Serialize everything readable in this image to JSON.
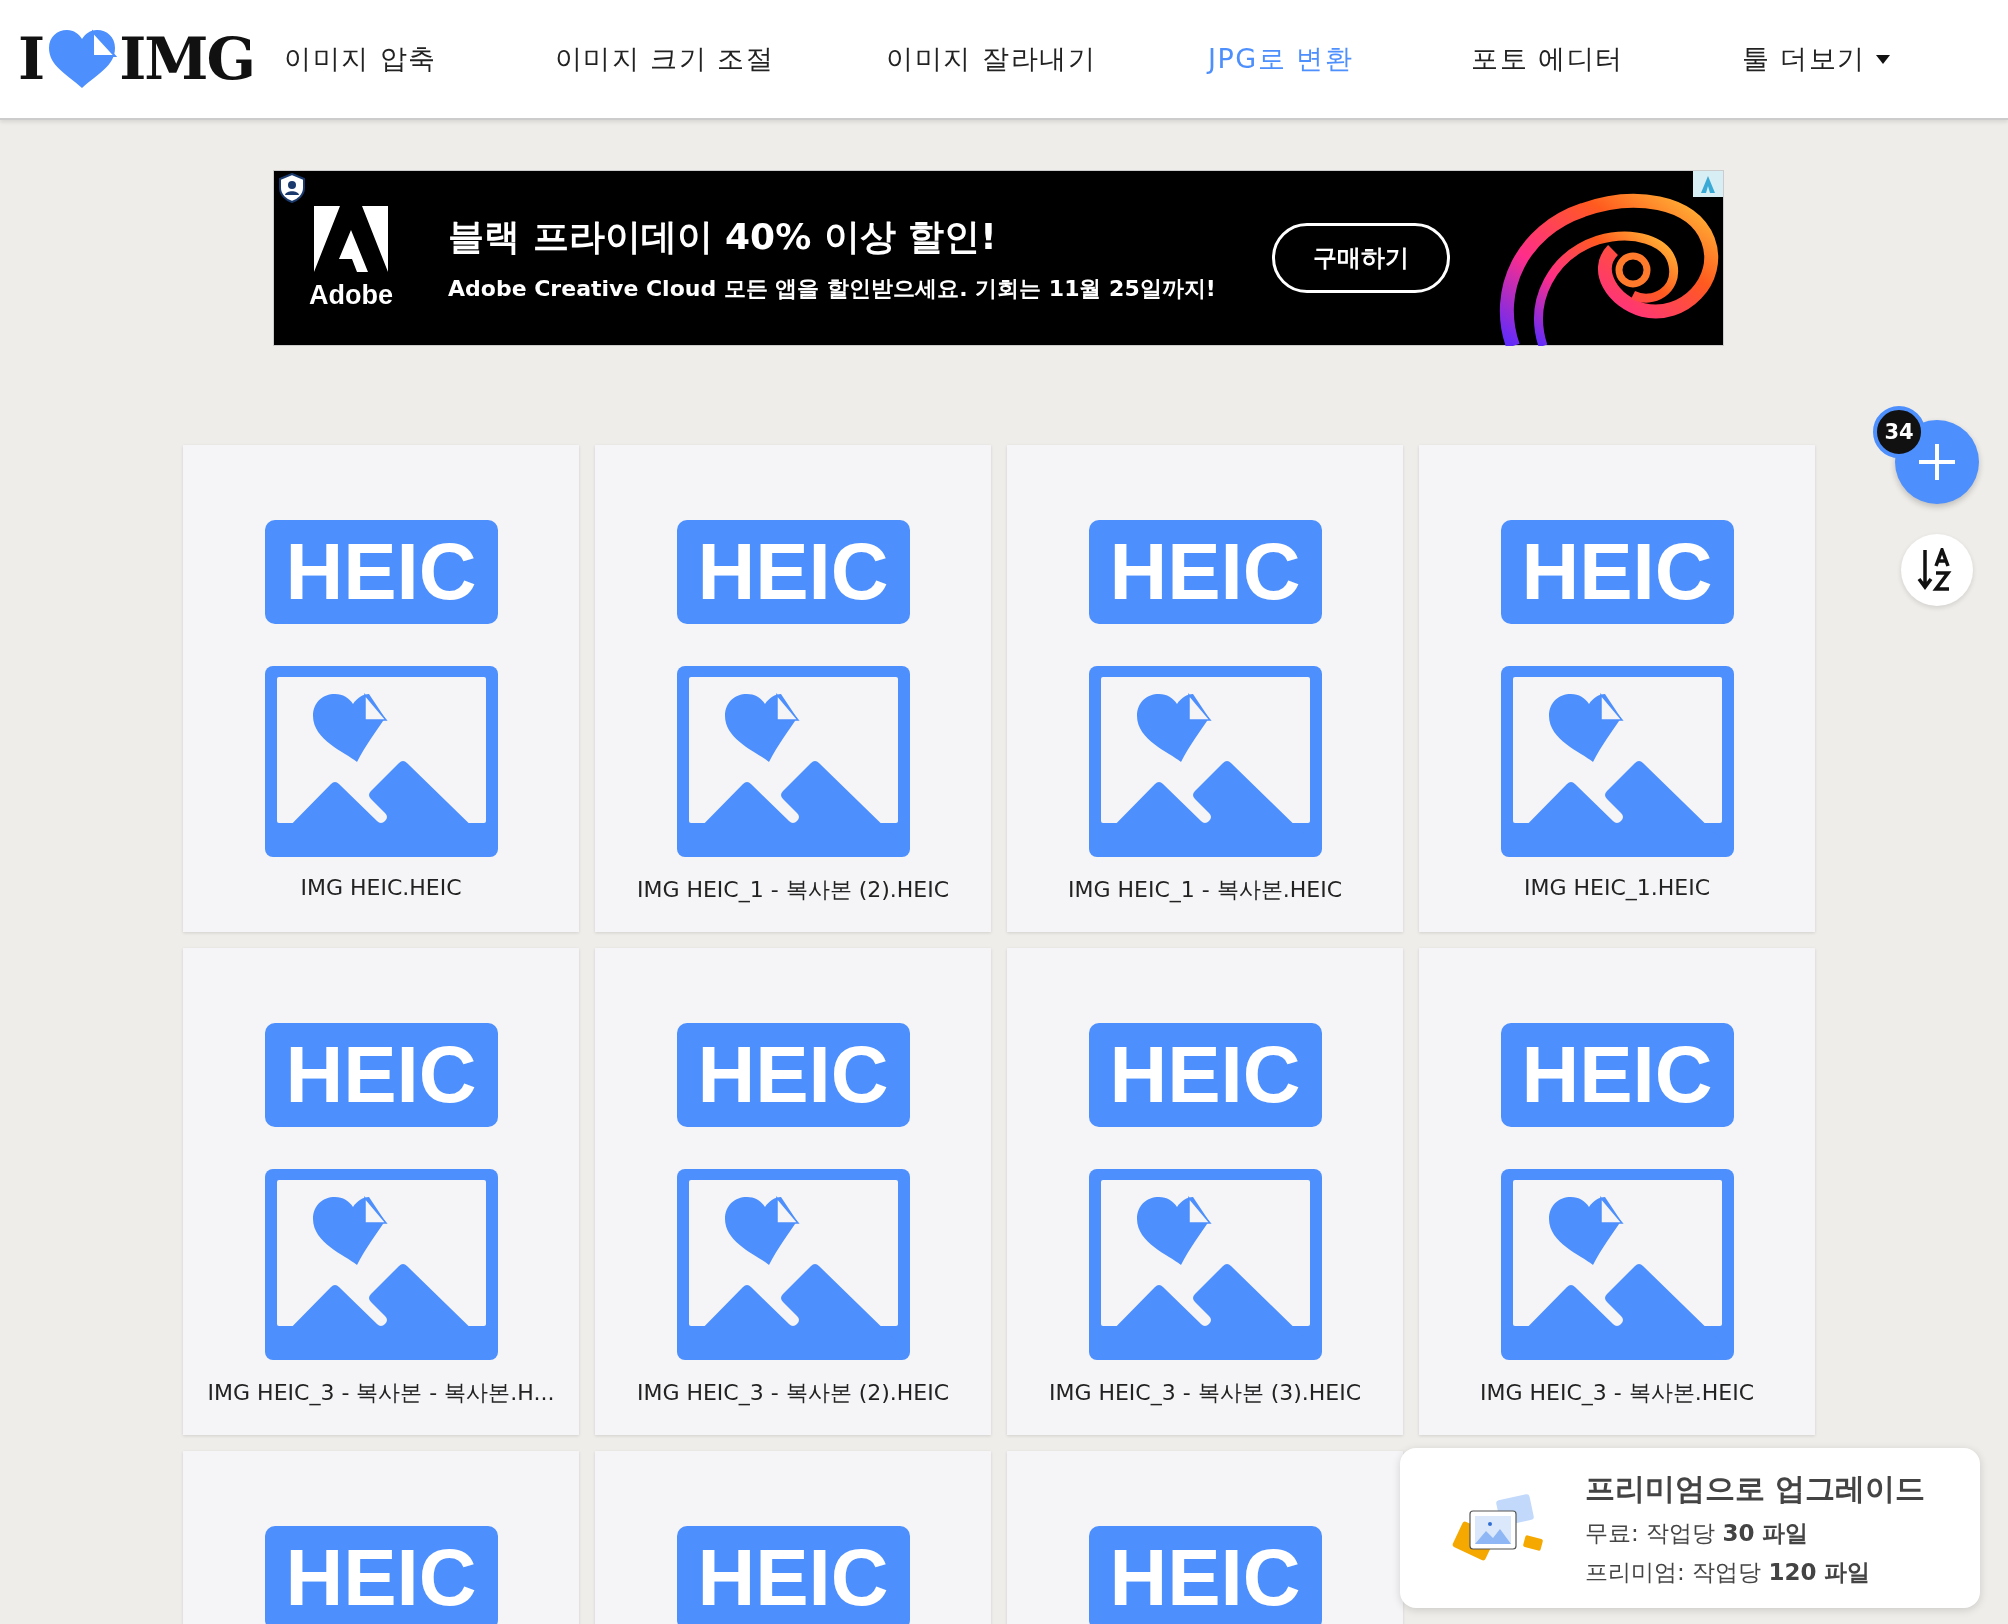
{
  "logo": {
    "left": "I",
    "right": "IMG"
  },
  "nav": [
    {
      "label": "이미지 압축",
      "selected": false,
      "dropdown": false
    },
    {
      "label": "이미지 크기 조절",
      "selected": false,
      "dropdown": false
    },
    {
      "label": "이미지 잘라내기",
      "selected": false,
      "dropdown": false
    },
    {
      "label": "JPG로 변환",
      "selected": true,
      "dropdown": false
    },
    {
      "label": "포토 에디터",
      "selected": false,
      "dropdown": false
    },
    {
      "label": "툴 더보기",
      "selected": false,
      "dropdown": true
    }
  ],
  "ad": {
    "brand": "Adobe",
    "headline": "블랙 프라이데이 40% 이상 할인!",
    "subline": "Adobe Creative Cloud 모든 앱을 할인받으세요. 기회는 11월 25일까지!",
    "button": "구매하기"
  },
  "files": [
    {
      "format": "HEIC",
      "name": "IMG HEIC.HEIC"
    },
    {
      "format": "HEIC",
      "name": "IMG HEIC_1 - 복사본 (2).HEIC"
    },
    {
      "format": "HEIC",
      "name": "IMG HEIC_1 - 복사본.HEIC"
    },
    {
      "format": "HEIC",
      "name": "IMG HEIC_1.HEIC"
    },
    {
      "format": "HEIC",
      "name": "IMG HEIC_3 - 복사본 - 복사본.H..."
    },
    {
      "format": "HEIC",
      "name": "IMG HEIC_3 - 복사본 (2).HEIC"
    },
    {
      "format": "HEIC",
      "name": "IMG HEIC_3 - 복사본 (3).HEIC"
    },
    {
      "format": "HEIC",
      "name": "IMG HEIC_3 - 복사본.HEIC"
    },
    {
      "format": "HEIC"
    },
    {
      "format": "HEIC"
    },
    {
      "format": "HEIC"
    }
  ],
  "add_button": {
    "count": "34"
  },
  "upgrade_popup": {
    "title": "프리미엄으로 업그레이드",
    "lines": [
      "무료: 작업당 **30 파일**",
      "프리미엄: 작업당 **120 파일**"
    ]
  }
}
